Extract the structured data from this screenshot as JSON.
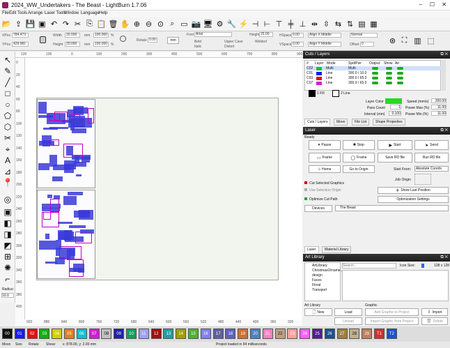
{
  "window": {
    "title": "2024_WW_Undertakers - The Beast - LightBurn 1.7.06",
    "controls": [
      "–",
      "☐",
      "✕"
    ]
  },
  "menu": [
    "File",
    "Edit",
    "Tools",
    "Arrange",
    "Laser Tools",
    "Window",
    "Language",
    "Help"
  ],
  "props": {
    "xpos_label": "XPos",
    "xpos": "784.473",
    "ypos_label": "YPos",
    "ypos": "429.981",
    "width_label": "Width",
    "width": "20.000",
    "height_label": "Height",
    "height": "20.000",
    "unit": "mm",
    "scale_w": "100.000",
    "scale_h": "100.000",
    "pct": "%",
    "rotate_label": "Rotate",
    "rotate": "0.00",
    "units_button": "mm",
    "font_label": "Font",
    "font": "Arial",
    "font_height_label": "Height",
    "font_height": "25.00",
    "bold": "Bold",
    "italic": "Italic",
    "upper": "Upper Case",
    "distort": "Distort",
    "welded": "Welded",
    "hspace_label": "HSpace",
    "hspace": "0.00",
    "vspace_label": "VSpace",
    "vspace": "0.00",
    "align_x": "Align X Middle",
    "align_y": "Align Y Middle",
    "normal": "Normal",
    "offset_label": "Offset",
    "offset": "0"
  },
  "rulers": {
    "top": [
      "120",
      "100",
      "0",
      "100",
      "200",
      "300",
      "400",
      "500",
      "600",
      "700",
      "800",
      "900"
    ],
    "bottom": [
      "920",
      "880",
      "840",
      "800",
      "760",
      "720",
      "680",
      "640",
      "600",
      "560",
      "520",
      "480",
      "440",
      "400",
      "360",
      "320"
    ],
    "left": [
      "0",
      "20",
      "40",
      "60",
      "80",
      "100",
      "120",
      "140",
      "160",
      "180",
      "200",
      "220",
      "240",
      "260",
      "280",
      "300",
      "320",
      "340",
      "360",
      "380",
      "400"
    ]
  },
  "lefttools": {
    "radius_label": "Radius:",
    "radius": "10.0"
  },
  "cuts": {
    "title": "Cuts / Layers",
    "headers": [
      "#",
      "Layer",
      "Mode",
      "Spd/Pwr",
      "Output",
      "Show",
      "Air"
    ],
    "rows": [
      {
        "num": "C02",
        "mode": "Multi",
        "spd": "Multi",
        "color": "#22c022"
      },
      {
        "num": "C01",
        "mode": "Line",
        "spd": "300.0 / 10.0",
        "color": "#1a1aff"
      },
      {
        "num": "C03",
        "mode": "Line",
        "spd": "300.0 / 65.0",
        "color": "#e01010"
      },
      {
        "num": "C07",
        "mode": "Line",
        "spd": "300.0 / 65.0",
        "color": "#d020d0"
      }
    ],
    "fill_label": "1 Fill",
    "line_label": "2 Line",
    "layer_color_label": "Layer Color",
    "layer_color": "#22dd22",
    "speed_label": "Speed (mm/s)",
    "speed": "200.00",
    "pass_label": "Pass Count",
    "pass": "1",
    "pmax_label": "Power Max (%)",
    "pmax": "11.00",
    "interval_label": "Interval (mm)",
    "interval": "0.100",
    "pmin_label": "Power Min (%)",
    "pmin": "11.00",
    "tabs": [
      "Cuts / Layers",
      "Move",
      "File List",
      "Shape Properties"
    ]
  },
  "laser": {
    "title": "Laser",
    "status": "Ready",
    "pause": "Pause",
    "stop": "Stop",
    "start": "Start",
    "send": "Send",
    "frame1": "Frame",
    "frame2": "Frame",
    "save_rd": "Save RD file",
    "run_rd": "Run RD file",
    "home": "Home",
    "goto_origin": "Go to Origin",
    "start_from_label": "Start From:",
    "start_from": "Absolute Coords",
    "cut_selected": "Cut Selected Graphics",
    "use_selection": "Use Selection Origin",
    "job_origin": "Job Origin",
    "show_last": "Show Last Position",
    "optimize_cut": "Optimize Cut Path",
    "optimization": "Optimization Settings",
    "devices": "Devices",
    "device": "The Beast",
    "tabs": [
      "Laser",
      "Material Library"
    ]
  },
  "art": {
    "title": "Art Library",
    "search_placeholder": "Search...",
    "icon_size_label": "Icon Size:",
    "icon_size": "128 x 128",
    "items": [
      "ArtLibrary",
      "ChristmasOrname...",
      "design",
      "Faces",
      "Floral",
      "Transport"
    ],
    "group1": "Art Library",
    "group2": "Graphic",
    "new": "New",
    "load": "Load",
    "unload": "Unload",
    "add_graphic": "Add Graphic to Project",
    "import_graphic": "Import Graphic from Project",
    "import": "Import",
    "delete": "Delete"
  },
  "palette": [
    {
      "label": "00",
      "color": "#111111"
    },
    {
      "label": "01",
      "color": "#1a1aff"
    },
    {
      "label": "02",
      "color": "#e01010"
    },
    {
      "label": "03",
      "color": "#10b010"
    },
    {
      "label": "04",
      "color": "#d0d000"
    },
    {
      "label": "05",
      "color": "#e08020"
    },
    {
      "label": "06",
      "color": "#10c0d0"
    },
    {
      "label": "07",
      "color": "#d020d0"
    },
    {
      "label": "08",
      "color": "#c0c0c0"
    },
    {
      "label": "09",
      "color": "#2020b0"
    },
    {
      "label": "10",
      "color": "#10a060"
    },
    {
      "label": "11",
      "color": "#a0a0ff"
    },
    {
      "label": "12",
      "color": "#a01010"
    },
    {
      "label": "13",
      "color": "#20a0a0"
    },
    {
      "label": "14",
      "color": "#a0a000"
    },
    {
      "label": "15",
      "color": "#50b030"
    },
    {
      "label": "16",
      "color": "#8080ff"
    },
    {
      "label": "17",
      "color": "#6060a0"
    },
    {
      "label": "18",
      "color": "#6060c0"
    },
    {
      "label": "19",
      "color": "#d07030"
    },
    {
      "label": "20",
      "color": "#5080c0"
    },
    {
      "label": "21",
      "color": "#ff80c0"
    },
    {
      "label": "22",
      "color": "#c0a080"
    },
    {
      "label": "23",
      "color": "#ffa0a0"
    },
    {
      "label": "24",
      "color": "#ff60ff"
    },
    {
      "label": "25",
      "color": "#502090"
    },
    {
      "label": "26",
      "color": "#205090"
    },
    {
      "label": "27",
      "color": "#a08040"
    },
    {
      "label": "28",
      "color": "#c0b090"
    },
    {
      "label": "29",
      "color": "#c08060"
    },
    {
      "label": "T1",
      "color": "#d03030"
    },
    {
      "label": "T2",
      "color": "#2050d0"
    }
  ],
  "status": {
    "move": "Move",
    "size": "Size",
    "rotate": "Rotate",
    "shear": "Shear",
    "coords": "x: 878.00, y: 2.00 mm",
    "message": "Project loaded in 94 milliseconds"
  }
}
